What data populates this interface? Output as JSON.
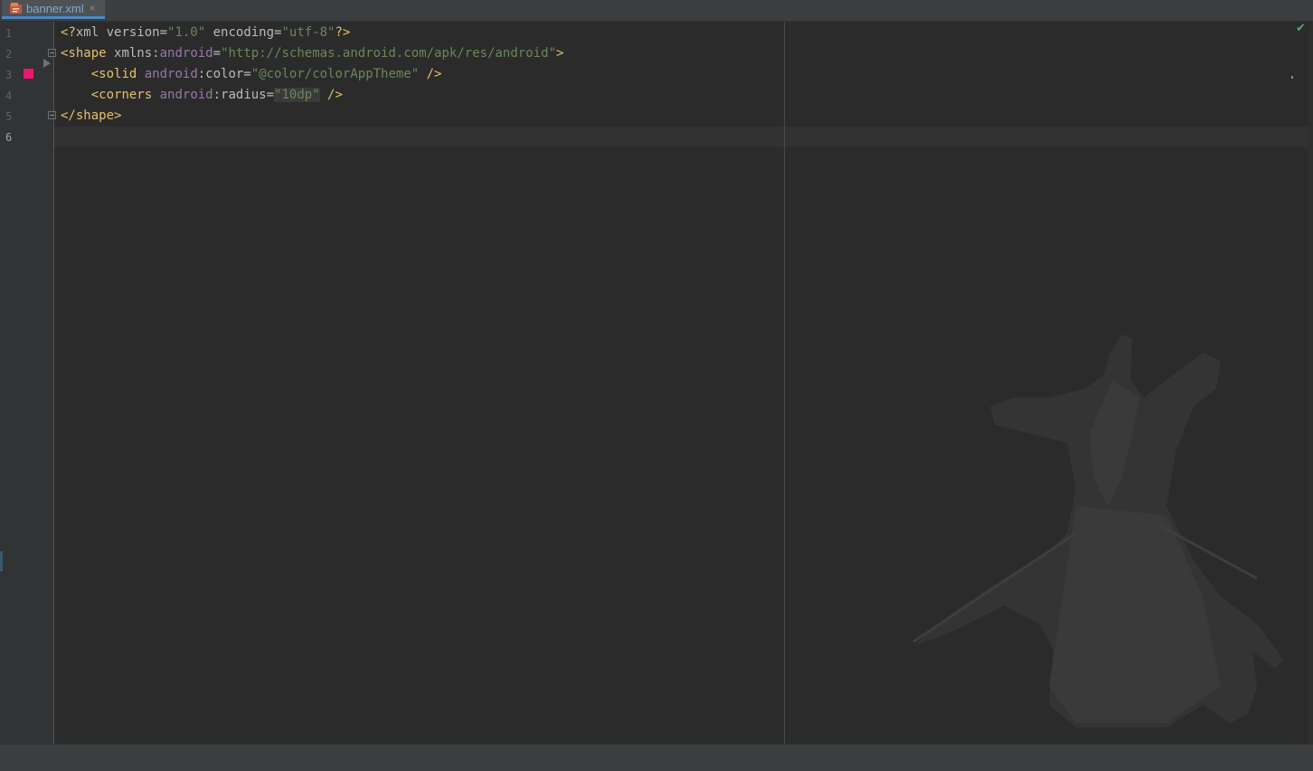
{
  "tab": {
    "icon": "xml-file-icon",
    "label": "banner.xml",
    "close_glyph": "×"
  },
  "gutter": {
    "line_numbers": [
      "1",
      "2",
      "3",
      "4",
      "5",
      "6"
    ],
    "color_swatch": "#e6196f"
  },
  "code": {
    "line1": {
      "open": "<?",
      "tag": "xml",
      "attr1": " version=",
      "val1": "\"1.0\"",
      "attr2": " encoding=",
      "val2": "\"utf-8\"",
      "close": "?>"
    },
    "line2": {
      "open": "<",
      "tag": "shape",
      "attr": " xmlns:",
      "ns": "android",
      "eq": "=",
      "val": "\"http://schemas.android.com/apk/res/android\"",
      "close": ">"
    },
    "line3": {
      "indent": "    ",
      "open": "<",
      "tag": "solid",
      "ns": " android",
      "attr": ":color=",
      "val": "\"@color/colorAppTheme\"",
      "close": " />"
    },
    "line4": {
      "indent": "    ",
      "open": "<",
      "tag": "corners",
      "ns": " android",
      "attr": ":radius=",
      "val": "\"10dp\"",
      "close": " />"
    },
    "line5": {
      "open": "</",
      "tag": "shape",
      "close": ">"
    }
  },
  "status": {
    "inspection_icon": "check-icon",
    "inspection_glyph": "✔"
  },
  "colors": {
    "background": "#2b2b2b",
    "tag": "#e8bf6a",
    "namespace": "#9876aa",
    "string": "#6a8759",
    "accent": "#4a88c7"
  }
}
